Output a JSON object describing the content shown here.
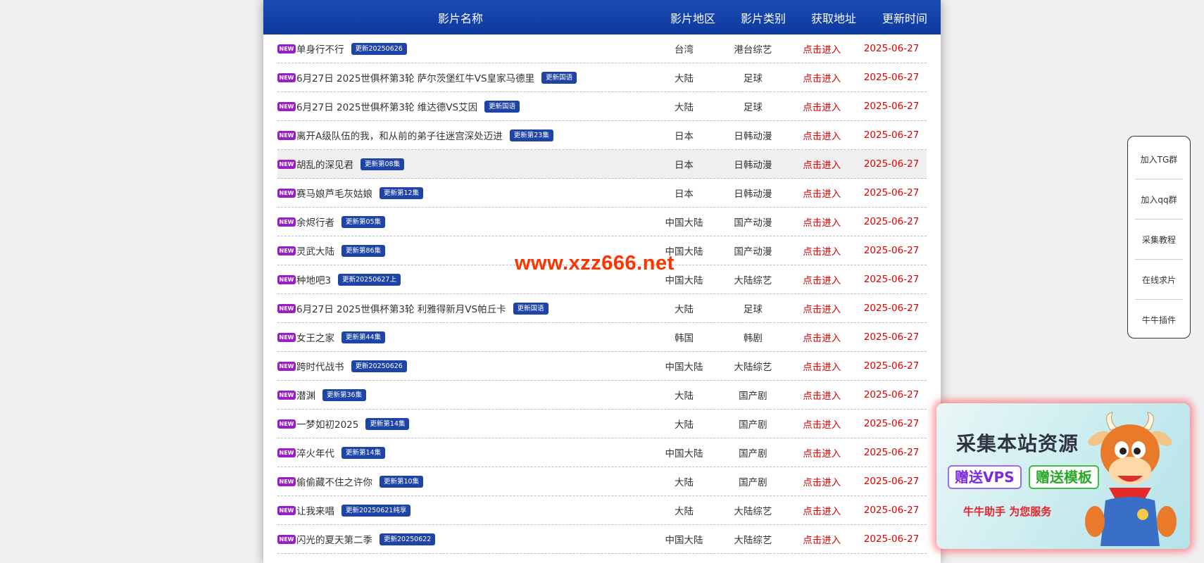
{
  "header": {
    "name": "影片名称",
    "region": "影片地区",
    "category": "影片类别",
    "link": "获取地址",
    "time": "更新时间"
  },
  "new_badge": "NEW",
  "rows": [
    {
      "title": "单身行不行",
      "update": "更新20250626",
      "region": "台湾",
      "category": "港台综艺",
      "link": "点击进入",
      "time": "2025-06-27"
    },
    {
      "title": "6月27日 2025世俱杯第3轮 萨尔茨堡红牛VS皇家马德里",
      "update": "更新国语",
      "region": "大陆",
      "category": "足球",
      "link": "点击进入",
      "time": "2025-06-27"
    },
    {
      "title": "6月27日 2025世俱杯第3轮 维达德VS艾因",
      "update": "更新国语",
      "region": "大陆",
      "category": "足球",
      "link": "点击进入",
      "time": "2025-06-27"
    },
    {
      "title": "离开A级队伍的我，和从前的弟子往迷宫深处迈进",
      "update": "更新第23集",
      "region": "日本",
      "category": "日韩动漫",
      "link": "点击进入",
      "time": "2025-06-27"
    },
    {
      "title": "胡乱的深见君",
      "update": "更新第08集",
      "region": "日本",
      "category": "日韩动漫",
      "link": "点击进入",
      "time": "2025-06-27"
    },
    {
      "title": "赛马娘芦毛灰姑娘",
      "update": "更新第12集",
      "region": "日本",
      "category": "日韩动漫",
      "link": "点击进入",
      "time": "2025-06-27"
    },
    {
      "title": "余烬行者",
      "update": "更新第05集",
      "region": "中国大陆",
      "category": "国产动漫",
      "link": "点击进入",
      "time": "2025-06-27"
    },
    {
      "title": "灵武大陆",
      "update": "更新第86集",
      "region": "中国大陆",
      "category": "国产动漫",
      "link": "点击进入",
      "time": "2025-06-27"
    },
    {
      "title": "种地吧3",
      "update": "更新20250627上",
      "region": "中国大陆",
      "category": "大陆综艺",
      "link": "点击进入",
      "time": "2025-06-27"
    },
    {
      "title": "6月27日 2025世俱杯第3轮 利雅得新月VS帕丘卡",
      "update": "更新国语",
      "region": "大陆",
      "category": "足球",
      "link": "点击进入",
      "time": "2025-06-27"
    },
    {
      "title": "女王之家",
      "update": "更新第44集",
      "region": "韩国",
      "category": "韩剧",
      "link": "点击进入",
      "time": "2025-06-27"
    },
    {
      "title": "跨时代战书",
      "update": "更新20250626",
      "region": "中国大陆",
      "category": "大陆综艺",
      "link": "点击进入",
      "time": "2025-06-27"
    },
    {
      "title": "潜渊",
      "update": "更新第36集",
      "region": "大陆",
      "category": "国产剧",
      "link": "点击进入",
      "time": "2025-06-27"
    },
    {
      "title": "一梦如初2025",
      "update": "更新第14集",
      "region": "大陆",
      "category": "国产剧",
      "link": "点击进入",
      "time": "2025-06-27"
    },
    {
      "title": "淬火年代",
      "update": "更新第14集",
      "region": "中国大陆",
      "category": "国产剧",
      "link": "点击进入",
      "time": "2025-06-27"
    },
    {
      "title": "偷偷藏不住之许你",
      "update": "更新第10集",
      "region": "大陆",
      "category": "国产剧",
      "link": "点击进入",
      "time": "2025-06-27"
    },
    {
      "title": "让我来唱",
      "update": "更新20250621纯享",
      "region": "大陆",
      "category": "大陆综艺",
      "link": "点击进入",
      "time": "2025-06-27"
    },
    {
      "title": "闪光的夏天第二季",
      "update": "更新20250622",
      "region": "中国大陆",
      "category": "大陆综艺",
      "link": "点击进入",
      "time": "2025-06-27"
    }
  ],
  "watermark": "www.xzz666.net",
  "side_menu": [
    "加入TG群",
    "加入qq群",
    "采集教程",
    "在线求片",
    "牛牛插件"
  ],
  "ad": {
    "title": "采集本站资源",
    "button1": "赠送VPS",
    "button2": "赠送模板",
    "subtitle": "牛牛助手 为您服务"
  },
  "colors": {
    "header_bg": "#0d3a9e",
    "link_red": "#e00000",
    "new_badge": "#9a1ec8",
    "update_badge": "#1e44a8",
    "watermark": "#ff3300"
  }
}
